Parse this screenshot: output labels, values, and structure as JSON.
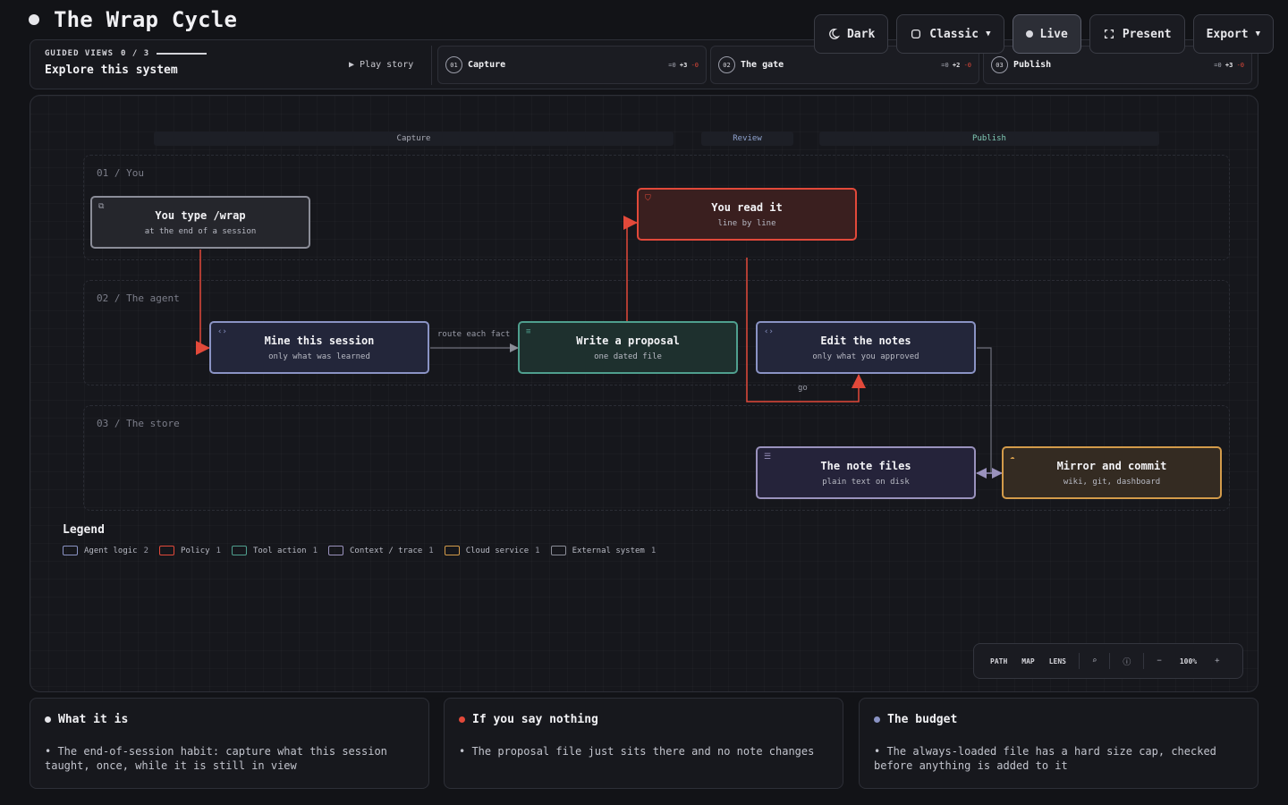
{
  "header": {
    "title": "The Wrap Cycle"
  },
  "toolbar": {
    "theme_label": "Dark",
    "style_label": "Classic",
    "live_label": "Live",
    "present_label": "Present",
    "export_label": "Export"
  },
  "guided": {
    "label": "GUIDED VIEWS",
    "progress": "0 / 3",
    "subtitle": "Explore this system",
    "play_label": "▶ Play story",
    "steps": [
      {
        "num": "01",
        "name": "Capture",
        "stats_eq": "=0",
        "stats_plus": "+3",
        "stats_minus": "-0"
      },
      {
        "num": "02",
        "name": "The gate",
        "stats_eq": "=0",
        "stats_plus": "+2",
        "stats_minus": "-0"
      },
      {
        "num": "03",
        "name": "Publish",
        "stats_eq": "=0",
        "stats_plus": "+3",
        "stats_minus": "-0"
      }
    ]
  },
  "diagram": {
    "phases": [
      "Capture",
      "Review",
      "Publish"
    ],
    "lanes": [
      "01 / You",
      "02 / The agent",
      "03 / The store"
    ],
    "nodes": {
      "type_wrap": {
        "title": "You type /wrap",
        "sub": "at the end of a session"
      },
      "read_it": {
        "title": "You read it",
        "sub": "line by line"
      },
      "mine": {
        "title": "Mine this session",
        "sub": "only what was learned"
      },
      "proposal": {
        "title": "Write a proposal",
        "sub": "one dated file"
      },
      "edit": {
        "title": "Edit the notes",
        "sub": "only what you approved"
      },
      "note_files": {
        "title": "The note files",
        "sub": "plain text on disk"
      },
      "mirror": {
        "title": "Mirror and commit",
        "sub": "wiki, git, dashboard"
      }
    },
    "edge_labels": {
      "route": "route each fact",
      "go": "go"
    }
  },
  "legend": {
    "title": "Legend",
    "items": [
      {
        "label": "Agent logic",
        "count": "2",
        "color": "#8a93c4"
      },
      {
        "label": "Policy",
        "count": "1",
        "color": "#e2493a"
      },
      {
        "label": "Tool action",
        "count": "1",
        "color": "#4f9f8e"
      },
      {
        "label": "Context / trace",
        "count": "1",
        "color": "#9a92bd"
      },
      {
        "label": "Cloud service",
        "count": "1",
        "color": "#d39b4a"
      },
      {
        "label": "External system",
        "count": "1",
        "color": "#8b8d98"
      }
    ]
  },
  "controls": {
    "path": "PATH",
    "map": "MAP",
    "lens": "LENS",
    "zoom": "100%",
    "minus": "−",
    "plus": "+"
  },
  "cards": [
    {
      "title": "What it is",
      "dot": "#e6e6ea",
      "body": "• The end-of-session habit: capture what this session taught, once, while it is still in view"
    },
    {
      "title": "If you say nothing",
      "dot": "#e2493a",
      "body": "• The proposal file just sits there and no note changes"
    },
    {
      "title": "The budget",
      "dot": "#8a93c4",
      "body": "• The always-loaded file has a hard size cap, checked before anything is added to it"
    }
  ],
  "colors": {
    "accent_red": "#e2493a",
    "agent": "#8a93c4",
    "tool": "#4f9f8e",
    "cloud": "#d39b4a"
  }
}
